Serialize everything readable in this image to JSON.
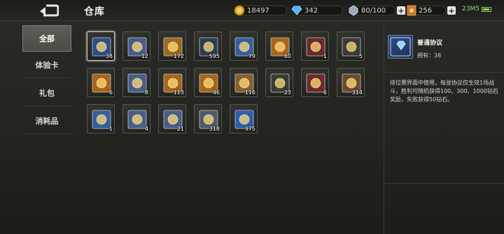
{
  "header": {
    "title": "仓库",
    "gold": "18497",
    "diamond": "342",
    "energy": "80/100",
    "tickets": "256",
    "battery": "23M5"
  },
  "sidebar": {
    "items": [
      {
        "label": "全部"
      },
      {
        "label": "体验卡"
      },
      {
        "label": "礼包"
      },
      {
        "label": "消耗品"
      }
    ]
  },
  "items": [
    {
      "count": "38",
      "icon": "pact-diamond-card-icon",
      "color": "#2f4e86"
    },
    {
      "count": "12",
      "icon": "coin-ticket-blue-icon",
      "color": "#4a5d86"
    },
    {
      "count": "172",
      "icon": "green-scroll-card-icon",
      "color": "#9a6a1d"
    },
    {
      "count": "595",
      "icon": "bullet-magazine-icon",
      "color": "#2d3c52"
    },
    {
      "count": "79",
      "icon": "coin-pact-card-icon",
      "color": "#355e9a"
    },
    {
      "count": "60",
      "icon": "gold-treasure-card-icon",
      "color": "#a8641a"
    },
    {
      "count": "1",
      "icon": "skull-gem-icon",
      "color": "#6b2a2a"
    },
    {
      "count": "5",
      "icon": "white-bag-icon",
      "color": "#3a3b35"
    },
    {
      "count": "6",
      "icon": "pact-diamond-card-gold-icon",
      "color": "#a8641a"
    },
    {
      "count": "8",
      "icon": "coin-ticket-blue-icon",
      "color": "#4a5d86"
    },
    {
      "count": "113",
      "icon": "gold-coin-card-icon",
      "color": "#a8641a"
    },
    {
      "count": "46",
      "icon": "coin-pact-gold-card-icon",
      "color": "#a8641a"
    },
    {
      "count": "116",
      "icon": "brown-book-icon",
      "color": "#8a5f2e"
    },
    {
      "count": "23",
      "icon": "walkie-talkie-icon",
      "color": "#3a3b35"
    },
    {
      "count": "6",
      "icon": "red-firecracker-icon",
      "color": "#6b2a2a"
    },
    {
      "count": "314",
      "icon": "brown-book-icon",
      "color": "#6b4a2a"
    },
    {
      "count": "1",
      "icon": "rename-card-icon",
      "color": "#355e9a"
    },
    {
      "count": "4",
      "icon": "coin-ticket-blue-icon",
      "color": "#4a5d86"
    },
    {
      "count": "21",
      "icon": "coin-ticket-blue-icon",
      "color": "#4a5d86"
    },
    {
      "count": "318",
      "icon": "grey-book-icon",
      "color": "#4e5b6b"
    },
    {
      "count": "975",
      "icon": "blue-ticket-icon",
      "color": "#2f5da8"
    }
  ],
  "detail": {
    "name": "普通协议",
    "owned": "拥有：38",
    "description": "排位赛界面中使用，每张协议仅生效1场战斗，胜利可随机获得100、300、1000钻石奖励，失败获得50钻石。"
  }
}
